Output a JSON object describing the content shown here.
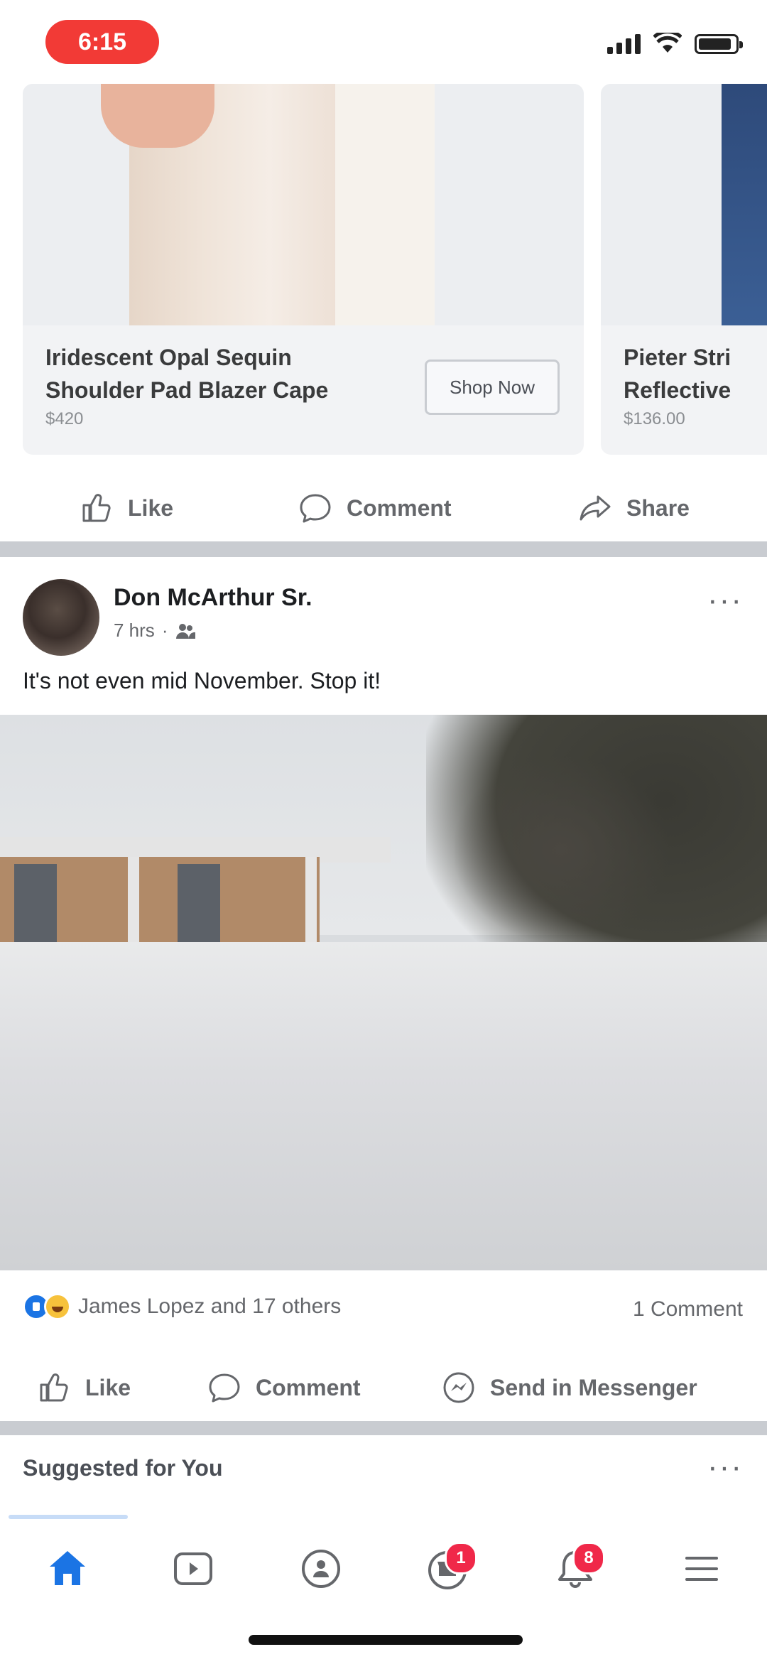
{
  "status_bar": {
    "time": "6:15"
  },
  "ad_carousel": {
    "cards": [
      {
        "title_line1": "Iridescent Opal Sequin",
        "title_line2": "Shoulder Pad Blazer Cape",
        "price": "$420",
        "cta": "Shop Now"
      },
      {
        "title_line1": "Pieter Stri",
        "title_line2": "Reflective",
        "price": "$136.00"
      }
    ],
    "actions": {
      "like": "Like",
      "comment": "Comment",
      "share": "Share"
    }
  },
  "post": {
    "author": "Don McArthur Sr.",
    "time": "7 hrs",
    "privacy_icon": "friends-icon",
    "text": "It's not even mid November. Stop it!",
    "reactions_text": "James Lopez and 17 others",
    "comment_count": "1 Comment",
    "actions": {
      "like": "Like",
      "comment": "Comment",
      "send": "Send in Messenger"
    }
  },
  "suggested": {
    "title": "Suggested for You"
  },
  "tab_bar": {
    "tabs": [
      {
        "icon": "home-icon",
        "active": true
      },
      {
        "icon": "watch-icon"
      },
      {
        "icon": "groups-icon"
      },
      {
        "icon": "marketplace-icon",
        "badge": "1"
      },
      {
        "icon": "notifications-icon",
        "badge": "8"
      },
      {
        "icon": "menu-icon"
      }
    ]
  },
  "colors": {
    "accent": "#1b74e4",
    "badge": "#f02849",
    "time_pill": "#f23a36"
  }
}
